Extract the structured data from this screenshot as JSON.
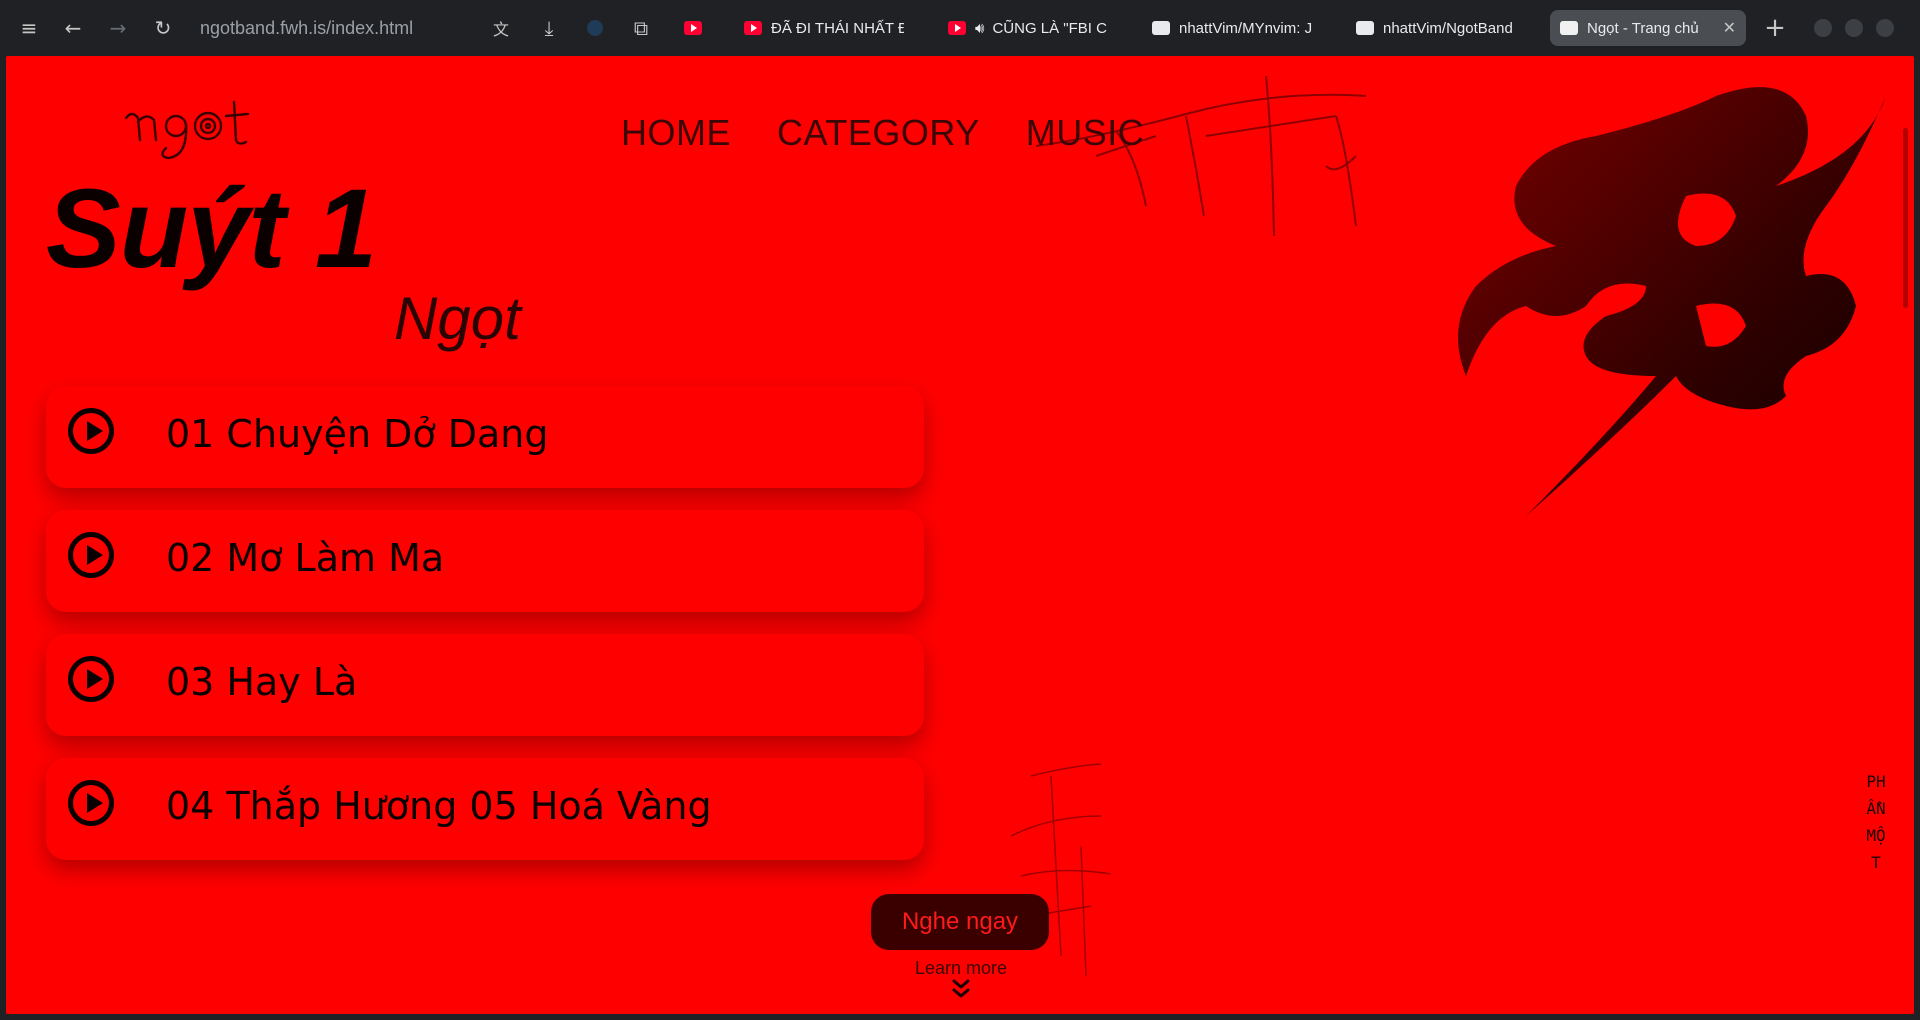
{
  "browser": {
    "url": "ngotband.fwh.is/index.html",
    "tabs": [
      {
        "title": "ĐÃ ĐI THÁI NHẤT Đ",
        "icon": "youtube-icon"
      },
      {
        "title": "CŨNG LÀ \"FBI C",
        "icon": "youtube-icon"
      },
      {
        "title": "nhattVim/MYnvim: J",
        "icon": "github-icon"
      },
      {
        "title": "nhattVim/NgotBand",
        "icon": "github-icon"
      },
      {
        "title": "Ngọt - Trang chủ",
        "icon": "site-icon",
        "active": true
      }
    ]
  },
  "header": {
    "logo_alt": "Ngọt",
    "nav": [
      {
        "label": "HOME"
      },
      {
        "label": "CATEGORY"
      },
      {
        "label": "MUSIC"
      }
    ]
  },
  "hero": {
    "album": "Suýt 1",
    "artist": "Ngọt"
  },
  "tracks": [
    {
      "label": "01 Chuyện Dở Dang"
    },
    {
      "label": "02 Mơ Làm Ma"
    },
    {
      "label": "03 Hay Là"
    },
    {
      "label": "04 Thắp Hương 05 Hoá Vàng"
    }
  ],
  "cta": {
    "listen_label": "Nghe ngay",
    "learn_more": "Learn more"
  },
  "side_text": "PHẦN   MỘT",
  "colors": {
    "page_bg": "#ff0000",
    "text_dark": "#0a0000",
    "button_bg": "#3a0000",
    "button_text": "#ff1a1a"
  }
}
